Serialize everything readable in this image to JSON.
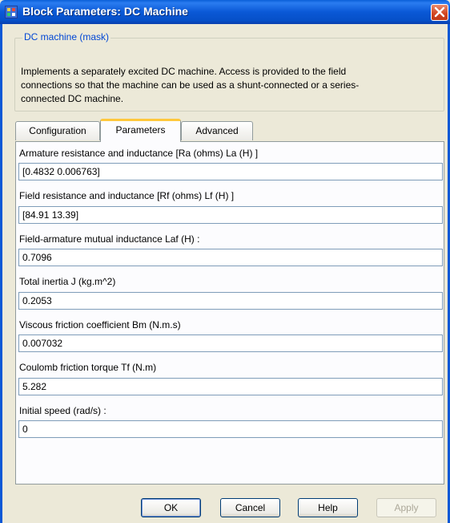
{
  "window": {
    "title": "Block Parameters: DC Machine",
    "icon": "simulink-block-icon",
    "close_icon": "close-icon"
  },
  "mask": {
    "legend": "DC machine (mask)",
    "description_lines": [
      "Implements a separately excited DC machine. Access is provided  to the field",
      "connections so that the machine can be used as a shunt-connected or a series-",
      "connected  DC machine."
    ]
  },
  "tabs": [
    {
      "label": "Configuration",
      "active": false
    },
    {
      "label": "Parameters",
      "active": true
    },
    {
      "label": "Advanced",
      "active": false
    }
  ],
  "parameters": [
    {
      "label": "Armature resistance and inductance [Ra (ohms) La (H) ]",
      "value": "[0.4832 0.006763]"
    },
    {
      "label": "Field resistance and inductance [Rf (ohms) Lf (H) ]",
      "value": "[84.91 13.39]"
    },
    {
      "label": "Field-armature mutual inductance Laf (H) :",
      "value": "0.7096"
    },
    {
      "label": "Total inertia J (kg.m^2)",
      "value": "0.2053"
    },
    {
      "label": "Viscous friction coefficient Bm (N.m.s)",
      "value": "0.007032"
    },
    {
      "label": "Coulomb friction torque Tf (N.m)",
      "value": "5.282"
    },
    {
      "label": "Initial speed (rad/s) :",
      "value": "0"
    }
  ],
  "buttons": {
    "ok": "OK",
    "cancel": "Cancel",
    "help": "Help",
    "apply": "Apply"
  },
  "colors": {
    "title_bar": "#0a58d6",
    "window_bg": "#ece9d8",
    "legend_text": "#0046d5",
    "active_tab_highlight": "#ffc83c"
  }
}
